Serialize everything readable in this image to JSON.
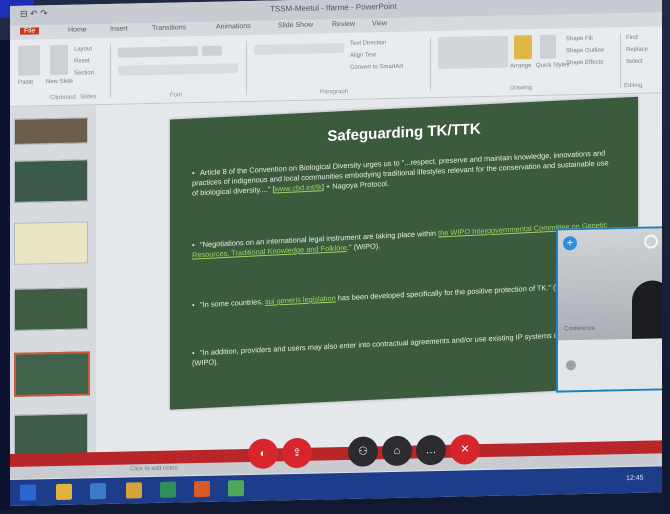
{
  "window": {
    "title": "TSSM-Meetul - Ifarme - PowerPoint",
    "quick_access": "⊟ ↶ ↷"
  },
  "ribbon": {
    "tabs": [
      "File",
      "Home",
      "Insert",
      "Transitions",
      "Animations",
      "Slide Show",
      "Review",
      "View"
    ],
    "groups": [
      "Clipboard",
      "Slides",
      "Font",
      "Paragraph",
      "Drawing",
      "Editing"
    ],
    "labels": [
      "Paste",
      "New Slide",
      "Layout",
      "Reset",
      "Section",
      "Text Direction",
      "Align Text",
      "Convert to SmartArt",
      "Arrange",
      "Quick Styles",
      "Shape Fill",
      "Shape Outline",
      "Shape Effects",
      "Find",
      "Replace",
      "Select"
    ]
  },
  "slide": {
    "title": "Safeguarding TK/TTK",
    "bullets": [
      {
        "prefix": "Article 8 of the Convention on Biological Diversity urges us to \"...respect, preserve and maintain knowledge, innovations and practices of indigenous and local communities embodying traditional lifestyles relevant for the conservation and sustainable use of biological diversity....\" [",
        "link": "www.cbd.int/tk",
        "suffix": "] + Nagoya Protocol."
      },
      {
        "prefix": "\"Negotiations on an international legal instrument are taking place within ",
        "link": "the WIPO Intergovernmental Committee on Genetic Resources, Traditional Knowledge and Folklore",
        "suffix": ".\" (WIPO)."
      },
      {
        "prefix": "\"In some countries, ",
        "link": "sui generis legislation",
        "suffix": " has been developed specifically for the positive protection of TK.\" (WIPO)."
      },
      {
        "prefix": "\"In addition, providers and users may also enter into contractual agreements and/or use existing IP systems of protection.\" (WIPO).",
        "link": "",
        "suffix": ""
      }
    ]
  },
  "thumbnails": [
    {
      "label": "slide-1"
    },
    {
      "label": "slide-2"
    },
    {
      "label": "slide-3"
    },
    {
      "label": "slide-4"
    },
    {
      "label": "slide-5"
    },
    {
      "label": "slide-6"
    }
  ],
  "status_bar": {
    "notes_text": "Click to add notes"
  },
  "video_call": {
    "participant_name": "Conference",
    "plus_glyph": "+"
  },
  "call_controls": {
    "buttons": [
      {
        "name": "video-button",
        "glyph": "◐"
      },
      {
        "name": "share-button",
        "glyph": "⇪"
      },
      {
        "name": "participants-button",
        "glyph": "⚇"
      },
      {
        "name": "chat-button",
        "glyph": "⌂"
      },
      {
        "name": "more-button",
        "glyph": "…"
      },
      {
        "name": "end-call-button",
        "glyph": "✕"
      }
    ]
  },
  "taskbar": {
    "clock": "12:45"
  },
  "colors": {
    "slide_bg": "#3c5a3c",
    "link": "#9fd36a",
    "call_red": "#d6262c",
    "taskbar": "#1d3d8a"
  }
}
